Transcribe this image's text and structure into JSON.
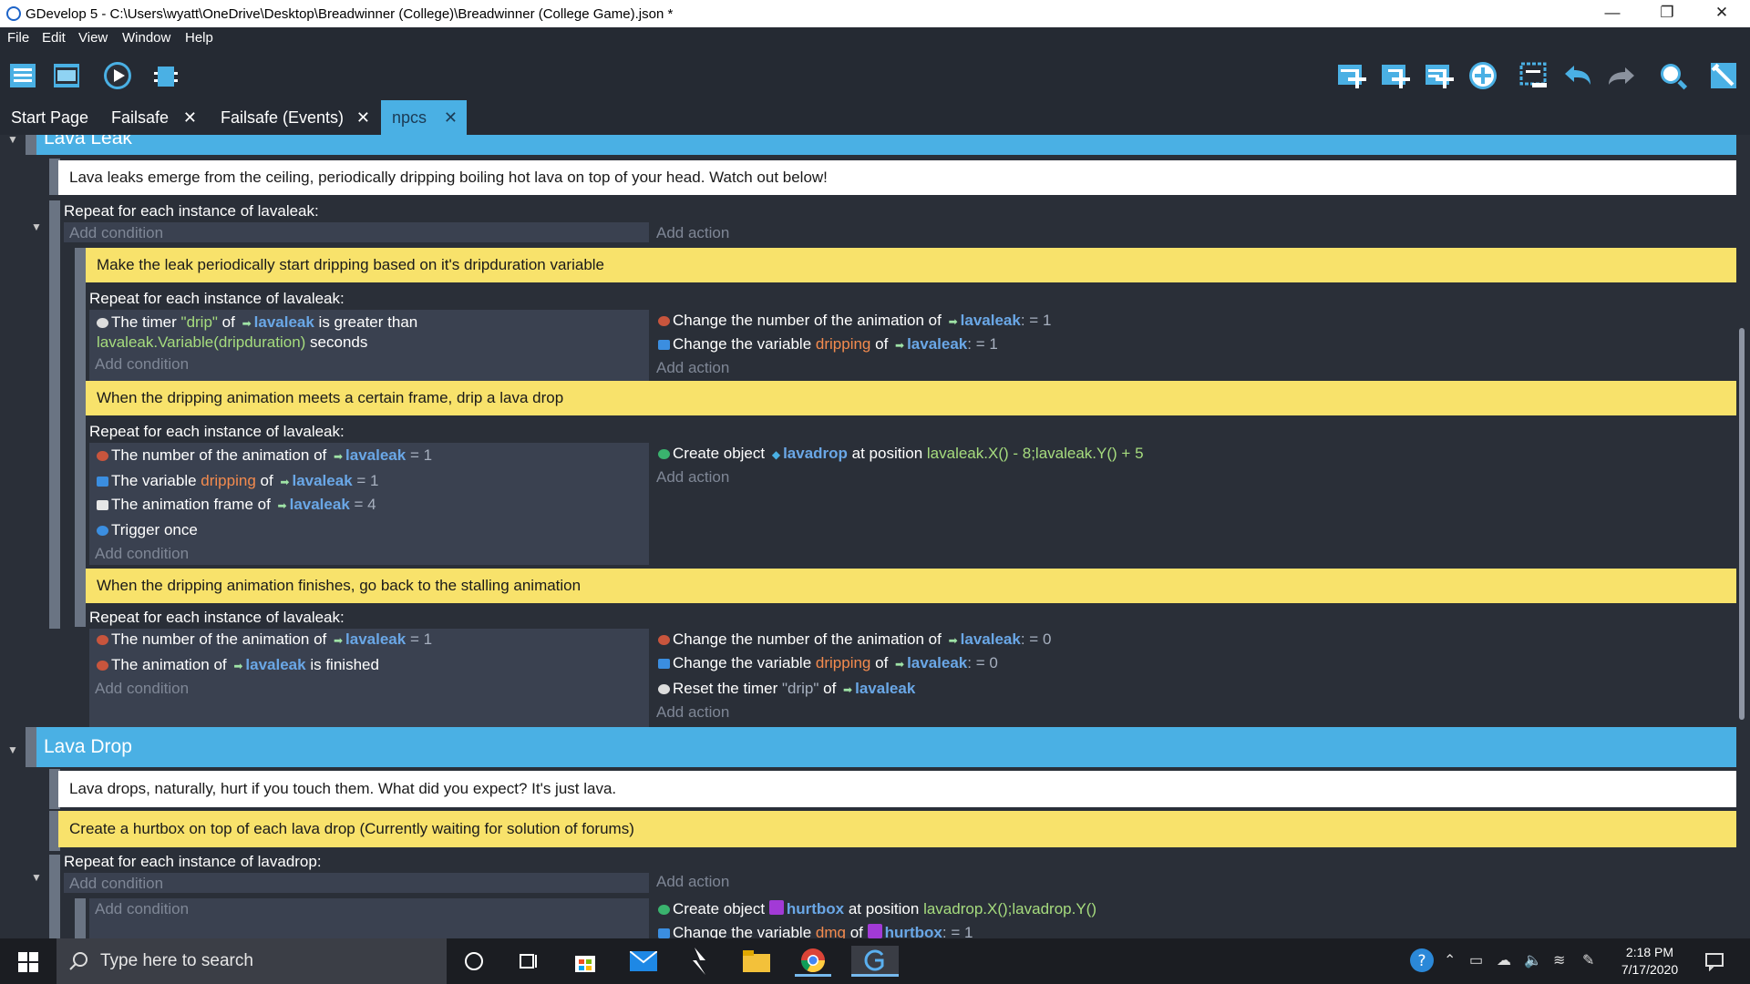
{
  "window": {
    "title": "GDevelop 5 - C:\\Users\\wyatt\\OneDrive\\Desktop\\Breadwinner (College)\\Breadwinner (College Game).json *",
    "minimize": "—",
    "maximize": "❐",
    "close": "✕"
  },
  "menu": [
    "File",
    "Edit",
    "View",
    "Window",
    "Help"
  ],
  "tabs": [
    {
      "label": "Start Page"
    },
    {
      "label": "Failsafe",
      "close": "✕"
    },
    {
      "label": "Failsafe (Events)",
      "close": "✕"
    },
    {
      "label": "npcs",
      "close": "✕"
    }
  ],
  "placeholders": {
    "add_condition": "Add condition",
    "add_action": "Add action"
  },
  "events": {
    "group1": {
      "title": "Lava Leak",
      "comment": "Lava leaks emerge from the ceiling, periodically dripping boiling hot lava on top of your head. Watch out below!",
      "repeat": "Repeat for each instance of lavaleak:",
      "c1": "Make the leak periodically start dripping based on it's dripduration variable",
      "s1": {
        "repeat": "Repeat for each instance of lavaleak:",
        "cond1": {
          "a": "The timer ",
          "b": "\"drip\"",
          "c": " of ",
          "obj": "lavaleak",
          "d": " is greater than",
          "e": "lavaleak.Variable(dripduration)",
          "f": " seconds"
        },
        "act1": {
          "a": "Change the number of the animation of ",
          "obj": "lavaleak",
          "b": ": = 1"
        },
        "act2": {
          "a": "Change the variable ",
          "var": "dripping",
          "b": " of ",
          "obj": "lavaleak",
          "c": ": = 1"
        }
      },
      "c2": "When the dripping animation meets a certain frame, drip a lava drop",
      "s2": {
        "repeat": "Repeat for each instance of lavaleak:",
        "cond1": {
          "a": "The number of the animation of ",
          "obj": "lavaleak",
          "b": " = 1"
        },
        "cond2": {
          "a": "The variable ",
          "var": "dripping",
          "b": " of ",
          "obj": "lavaleak",
          "c": " = 1"
        },
        "cond3": {
          "a": "The animation frame of ",
          "obj": "lavaleak",
          "b": " = 4"
        },
        "cond4": {
          "a": "Trigger once"
        },
        "act1": {
          "a": "Create object ",
          "obj": "lavadrop",
          "b": " at position ",
          "expr": "lavaleak.X() - 8;lavaleak.Y() + 5"
        }
      },
      "c3": "When the dripping animation finishes, go back to the stalling animation",
      "s3": {
        "repeat": "Repeat for each instance of lavaleak:",
        "cond1": {
          "a": "The number of the animation of ",
          "obj": "lavaleak",
          "b": " = 1"
        },
        "cond2": {
          "a": "The animation of ",
          "obj": "lavaleak",
          "b": " is finished"
        },
        "act1": {
          "a": "Change the number of the animation of ",
          "obj": "lavaleak",
          "b": ": = 0"
        },
        "act2": {
          "a": "Change the variable ",
          "var": "dripping",
          "b": " of ",
          "obj": "lavaleak",
          "c": ": = 0"
        },
        "act3": {
          "a": "Reset the timer ",
          "str": "\"drip\"",
          "b": " of ",
          "obj": "lavaleak"
        }
      }
    },
    "group2": {
      "title": "Lava Drop",
      "comment": "Lava drops, naturally, hurt if you touch them. What did you expect? It's just lava.",
      "c1": "Create a hurtbox on top of each lava drop (Currently waiting for solution of forums)",
      "repeat": "Repeat for each instance of lavadrop:",
      "act1": {
        "a": "Create object ",
        "obj": "hurtbox",
        "b": " at position ",
        "expr": "lavadrop.X();lavadrop.Y()"
      },
      "act2": {
        "a": "Change the variable ",
        "var": "dmg",
        "b": " of ",
        "obj": "hurtbox",
        "c": ": = 1"
      }
    }
  },
  "taskbar": {
    "search": "Type here to search",
    "time": "2:18 PM",
    "date": "7/17/2020"
  },
  "colors": {
    "group_bar": "#4ab0e4",
    "comment_yellow": "#f8e26b",
    "object": "#6aa7e6",
    "variable": "#f48b4e",
    "expression": "#a6dc7e"
  }
}
